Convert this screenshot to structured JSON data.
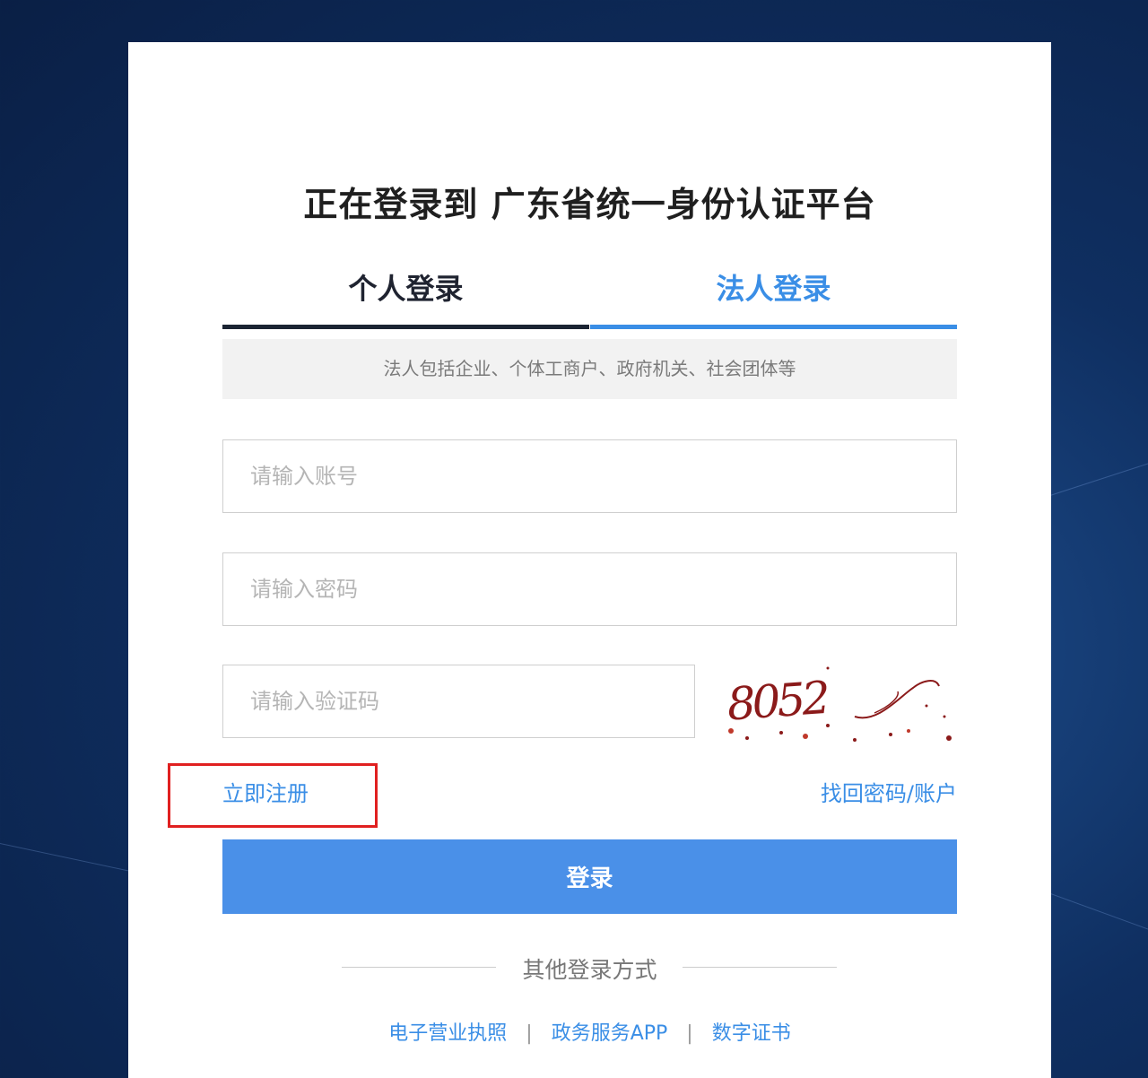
{
  "page": {
    "title": "正在登录到 广东省统一身份认证平台"
  },
  "tabs": [
    {
      "label": "个人登录",
      "active": false
    },
    {
      "label": "法人登录",
      "active": true
    }
  ],
  "hint": "法人包括企业、个体工商户、政府机关、社会团体等",
  "form": {
    "account_placeholder": "请输入账号",
    "password_placeholder": "请输入密码",
    "captcha_placeholder": "请输入验证码",
    "captcha_text": "8052"
  },
  "links": {
    "register": "立即注册",
    "forgot": "找回密码/账户"
  },
  "login_button": "登录",
  "other": {
    "label": "其他登录方式",
    "methods": [
      "电子营业执照",
      "政务服务APP",
      "数字证书"
    ],
    "separator": "|"
  },
  "colors": {
    "accent": "#3a8ee6",
    "button": "#4a90e8",
    "highlight": "#e02020",
    "captcha": "#8b1a1a"
  }
}
